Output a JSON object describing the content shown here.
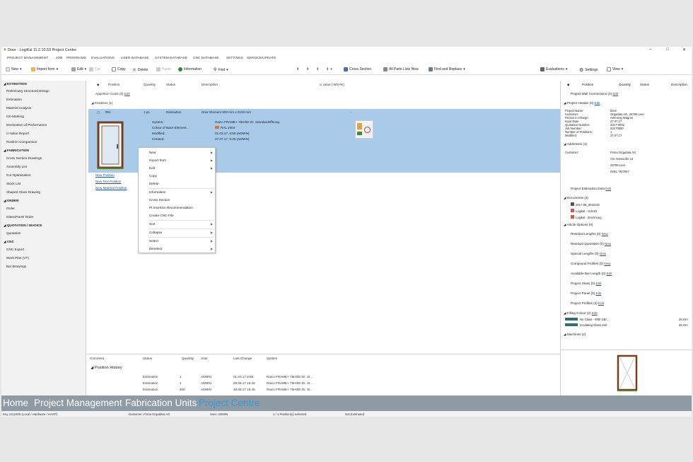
{
  "window": {
    "title": "Door - LogiKal 11.2.10.53 Project Centre"
  },
  "menu": [
    "PROJECT MANAGEMENT",
    "JOB",
    "PROGRAMS",
    "EVALUATIONS",
    "USER DATABASE",
    "SYSTEM DATABASE",
    "CNC DATABASE",
    "SETTINGS",
    "SERVICE/UPDATE"
  ],
  "toolbar": {
    "new": "New",
    "import_from": "Import from",
    "edit": "Edit",
    "cut": "Cut",
    "copy": "Copy",
    "delete": "Delete",
    "paste": "Paste",
    "information": "Information",
    "find": "Find",
    "cross_section": "Cross Section",
    "all_parts_lists_new": "All Parts Lists New",
    "find_and_replace": "Find and Replace",
    "evaluations": "Evaluations",
    "settings": "Settings",
    "view": "View"
  },
  "sidebar": {
    "sections": [
      {
        "label": "ESTIMATION",
        "items": [
          "Preliminary Structural Design",
          "Estimation",
          "Material Analysis",
          "CE-Marking",
          "Declaration of Performance",
          "U-Value Report",
          "Position Comparison"
        ]
      },
      {
        "label": "FABRICATION",
        "items": [
          "Cross Section Drawings",
          "Assembly List",
          "Cut Optimisation",
          "Stock List",
          "Shaped Glass Drawing"
        ]
      },
      {
        "label": "ORDER",
        "items": [
          "Order",
          "Glass/Panel Order"
        ]
      },
      {
        "label": "QUOTATION / INVOICE",
        "items": [
          "Quotation"
        ]
      },
      {
        "label": "CNC",
        "items": [
          "CNC Export",
          "Work Plan (VT)",
          "Bar Drawings"
        ]
      }
    ]
  },
  "center": {
    "columns": [
      "Position",
      "Quantity",
      "Status",
      "Description",
      "U value [ W/m²K]"
    ],
    "apportion_costs": "Apportion Costs (0)",
    "edit": "Edit",
    "positions_header": "Positions (1)",
    "row": {
      "position": "001",
      "quantity": "1 pc.",
      "status": "Estimation",
      "description": "Door Element 900 mm x 2100 mm"
    },
    "details": [
      {
        "k": "System:",
        "v": "Raico FRAME+ 75HI/DI DI. Standardöffnung"
      },
      {
        "k": "Colour of Base Element:",
        "v": "RAL 2004"
      },
      {
        "k": "Modified:",
        "v": "01.03.17, 8:58 (ADMIN)"
      },
      {
        "k": "Created:",
        "v": "27.07.17, 9:26 (ADMIN)"
      }
    ],
    "links": [
      "New Position",
      "New Text Position",
      "New Material Position"
    ]
  },
  "context_menu": [
    "New",
    "Import from",
    "Edit",
    "Copy",
    "Delete",
    "Information",
    "Cross Section",
    "Pt Insertion Recommendation",
    "Create CNC-File",
    "Sort",
    "Collapse",
    "Select",
    "Deselect"
  ],
  "history": {
    "columns": [
      "Comment",
      "Status",
      "Quantity",
      "User",
      "Last Change",
      "System"
    ],
    "title": "Position History",
    "rows": [
      {
        "status": "Estimation",
        "qty": "1",
        "user": "ADMIN",
        "change": "01.03.17  8:58",
        "system": "Raico FRAME+ 75HI/DI DI. St..."
      },
      {
        "status": "Estimation",
        "qty": "1",
        "user": "ADMIN",
        "change": "28.08.17  15:46",
        "system": "Raico FRAME+ 75HI/DI DI. St..."
      },
      {
        "status": "Estimation",
        "qty": "200",
        "user": "ADMIN",
        "change": "28.08.17  15:45",
        "system": "Raico FRAME+ 75HI/DI DI. St..."
      }
    ]
  },
  "right": {
    "columns": [
      "Position",
      "Quantity",
      "Status",
      "Description"
    ],
    "wall_connections": "Project Wall Connections (0)",
    "project_header": "Project Header (0)",
    "header_rows": [
      [
        "Project Name:",
        "Door"
      ],
      [
        "Customer:",
        "Orgadata AG, 26789 Leer"
      ],
      [
        "Person in Charge:",
        "Helmong Wagner"
      ],
      [
        "Input Date:",
        "27.07.17"
      ],
      [
        "Quotation Number:",
        "2017-0002"
      ],
      [
        "Job Number:",
        "20170820"
      ],
      [
        "Number of Positions:",
        "1"
      ],
      [
        "Modified:",
        "27.07.17"
      ]
    ],
    "addresses": "Addresses (1)",
    "customer_label": "Customer:",
    "customer_lines": [
      "Firma Orgadata AG",
      "Am Hessoufer 14",
      "26789 Leer",
      "0491 / 927927"
    ],
    "estimation_data": "Project Estimation Data",
    "documents": "Documents (3)",
    "docs": [
      "2017-08_001DCD",
      "Logikal - Schnitt",
      "Logikal - Zeichnung"
    ],
    "article_options": "Article Options (0)",
    "options": [
      {
        "label": "Residual Lengths (0)",
        "link": "New"
      },
      {
        "label": "Residual Quantities (0)",
        "link": "New"
      },
      {
        "label": "Special Lengths (0)",
        "link": "New"
      },
      {
        "label": "Compound Profiles (0)",
        "link": "New"
      },
      {
        "label": "Available Bar Length (0)",
        "link": "Edit"
      },
      {
        "label": "Project Glass (0)",
        "link": "Edit"
      },
      {
        "label": "Project Panel (0)",
        "link": "Edit"
      },
      {
        "label": "Project Profiles (0)",
        "link": "Edit"
      }
    ],
    "filling_colour": "Filling Colour (2)",
    "fillings": [
      {
        "name": "No Glass - With GB/...",
        "val": "28 mm"
      },
      {
        "name": "Insulating Glass Unit",
        "val": "36 mm"
      }
    ],
    "machines": "Machines (2)",
    "new": "New",
    "edit": "Edit"
  },
  "taskbar": [
    "Home",
    "Project Management",
    "Fabrication Units",
    "Project Centre"
  ],
  "status": [
    "Key 1212400 (Local / Hardware / HASP)",
    "Customer: Firma Orgadata AG",
    "User: ADMIN",
    "1 / 1 Position(s) selected",
    "Not Estimated"
  ],
  "colors": {
    "selection": "#a9cae8",
    "taskbar": "#8e9aa4",
    "active_tab": "#2f9be0",
    "link": "#1a4fb0"
  }
}
